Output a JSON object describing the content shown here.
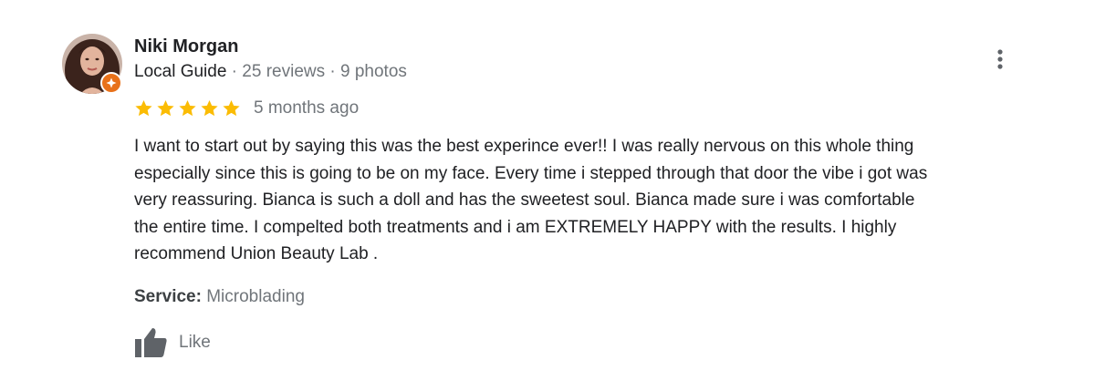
{
  "review": {
    "reviewer_name": "Niki Morgan",
    "reviewer_level": "Local Guide",
    "reviewer_stats": " · 25 reviews · 9 photos",
    "rating": 5,
    "rating_max": 5,
    "time_ago": "5 months ago",
    "text": "I want to start out by saying this was the best experince ever!! I was really nervous on this whole thing\nespecially since this is going to be on my face. Every time i stepped through that door the vibe i got was\nvery reassuring. Bianca is such a doll and has the sweetest soul. Bianca made sure i was comfortable\nthe entire time. I compelted  both treatments and i am EXTREMELY HAPPY with the results. I highly\nrecommend Union Beauty Lab       .",
    "service_label": "Service:",
    "service_value": " Microblading",
    "like_label": "Like"
  },
  "icons": {
    "avatar": "profile-photo",
    "badge": "local-guide-badge-icon",
    "more": "more-vertical-icon",
    "star": "star-icon",
    "like": "thumbs-up-icon"
  },
  "colors": {
    "star": "#fbbc04",
    "badge": "#e8711a",
    "text": "#202124",
    "secondary": "#70757a",
    "icon": "#5f6368"
  }
}
